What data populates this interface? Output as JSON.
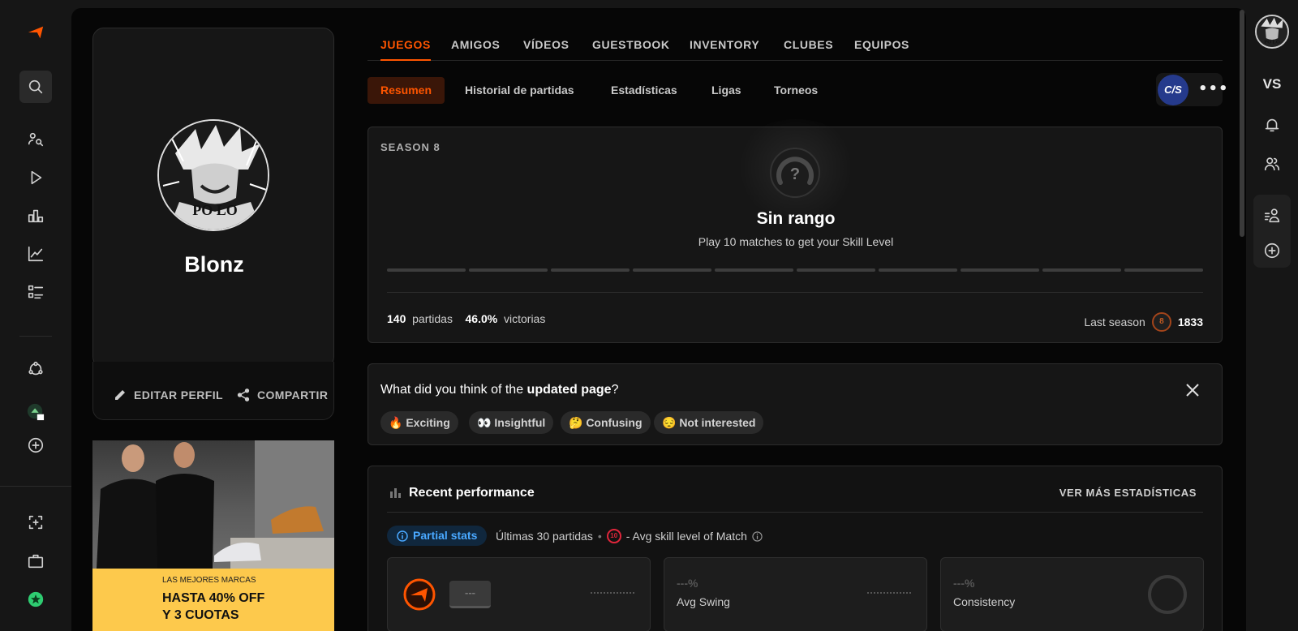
{
  "tabs": [
    "JUEGOS",
    "AMIGOS",
    "VÍDEOS",
    "GUESTBOOK",
    "INVENTORY",
    "CLUBES",
    "EQUIPOS"
  ],
  "subtabs": [
    "Resumen",
    "Historial de partidas",
    "Estadísticas",
    "Ligas",
    "Torneos"
  ],
  "game": {
    "logo_text": "C/S",
    "more": "•••"
  },
  "profile": {
    "username": "Blonz",
    "avatar_text": "PO LO",
    "edit_label": "EDITAR PERFIL",
    "share_label": "COMPARTIR"
  },
  "ad": {
    "small": "LAS MEJORES MARCAS",
    "line1": "HASTA 40% OFF",
    "line2": "Y 3 CUOTAS"
  },
  "season": {
    "label": "SEASON 8",
    "rank_title": "Sin rango",
    "rank_sub": "Play 10 matches to get your Skill Level",
    "rank_icon_text": "?",
    "segments": 10,
    "matches": "140",
    "matches_label": "partidas",
    "winrate": "46.0%",
    "winrate_label": "victorias",
    "last_season_label": "Last season",
    "last_season_level": "8",
    "last_season_elo": "1833"
  },
  "feedback": {
    "question_pre": "What did you think of the ",
    "question_bold": "updated page",
    "question_post": "?",
    "chips": [
      "🔥 Exciting",
      "👀 Insightful",
      "🤔 Confusing",
      "😔 Not interested"
    ]
  },
  "performance": {
    "title": "Recent performance",
    "link": "VER MÁS ESTADÍSTICAS",
    "partial": "Partial stats",
    "meta_matches": "Últimas 30 partidas",
    "meta_level": "10",
    "meta_avg": "- Avg skill level of Match",
    "boxes": [
      {
        "value": "---",
        "label": ""
      },
      {
        "value": "---%",
        "label": "Avg Swing"
      },
      {
        "value": "---%",
        "label": "Consistency"
      }
    ]
  },
  "right_rail": {
    "vs": "VS",
    "avatar_text": "PO LO"
  },
  "colors": {
    "accent": "#ff5500",
    "panel": "#060606",
    "card": "#161616",
    "info": "#49a8ff"
  }
}
